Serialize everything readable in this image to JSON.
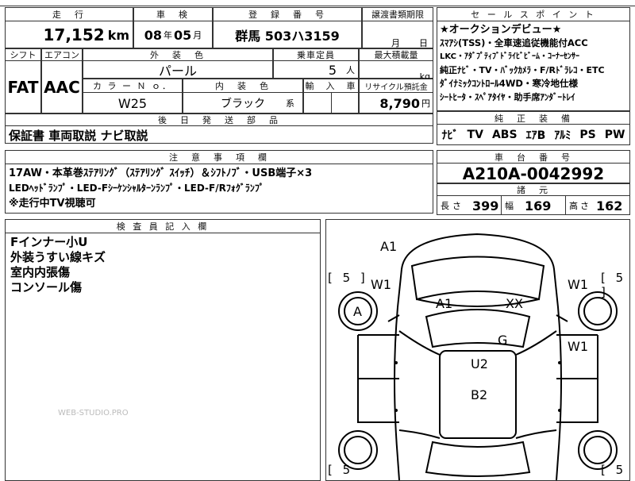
{
  "header_fragment": "",
  "mileage": {
    "label": "走　行",
    "value": "17,152",
    "unit": "km"
  },
  "inspection": {
    "label": "車　検",
    "year": "08",
    "year_unit": "年",
    "month": "05",
    "month_unit": "月"
  },
  "registration": {
    "label": "登　録　番　号",
    "value": "群馬 503ハ3159"
  },
  "transfer": {
    "label": "譲渡書類期限",
    "month_unit": "月",
    "day_unit": "日"
  },
  "shift": {
    "label": "シフト",
    "value": "FAT"
  },
  "aircon": {
    "label": "エアコン",
    "value": "AAC"
  },
  "exterior_color": {
    "label": "外　装　色",
    "value": "パール"
  },
  "capacity": {
    "label": "乗車定員",
    "value": "5",
    "unit": "人"
  },
  "max_load": {
    "label": "最大積載量",
    "unit": "kg"
  },
  "color_no": {
    "label": "カ ラ ー Ｎ ｏ．",
    "value": "W25"
  },
  "interior_color": {
    "label": "内　装　色",
    "value": "ブラック",
    "unit": "系"
  },
  "import": {
    "label": "輸　入　車"
  },
  "recycle": {
    "label": "リサイクル預託金",
    "value": "8,790",
    "unit": "円"
  },
  "later_parts": {
    "label": "後　日　発　送　部　品",
    "value": "保証書 車両取説 ナビ取説"
  },
  "sales_points": {
    "label": "セ ー ル ス ポ イ ン ト",
    "lines": [
      "★オークションデビュー★",
      "ｽﾏｱｼ(TSS)・全車速追従機能付ACC",
      "LKC・ｱﾀﾞﾌﾟﾃｨﾌﾞﾄﾞﾗｲﾋﾞﾋﾞｰﾑ・ｺｰﾅｰｾﾝｻｰ",
      "純正ﾅﾋﾞ・TV・ﾊﾞｯｸｶﾒﾗ・F/Rﾄﾞﾗﾚｺ・ETC",
      "ﾀﾞｲﾅﾐｯｸｺﾝﾄﾛｰﾙ4WD・寒冷地仕様",
      "ｼｰﾄﾋｰﾀ・ｽﾍﾟｱﾀｲﾔ・助手席ｱﾝﾀﾞｰﾄﾚｲ"
    ]
  },
  "equipment": {
    "label": "純　正　装　備",
    "items": [
      "ﾅﾋﾞ",
      "TV",
      "ABS",
      "ｴｱB",
      "ｱﾙﾐ",
      "PS",
      "PW"
    ]
  },
  "notes": {
    "label": "注　意　事　項　欄",
    "lines": [
      "17AW・本革巻ｽﾃｱﾘﾝｸﾞ（ｽﾃｱﾘﾝｸﾞ ｽｲｯﾁ）＆ｼﾌﾄﾉﾌﾞ・USB端子×3",
      "LEDﾍｯﾄﾞﾗﾝﾌﾟ・LED-Fｼｰｹﾝｼｬﾙﾀｰﾝﾗﾝﾌﾟ・LED-F/Rﾌｫｸﾞﾗﾝﾌﾟ",
      "※走行中TV視聴可"
    ]
  },
  "chassis": {
    "label": "車　台　番　号",
    "value": "A210A-0042992"
  },
  "dimensions": {
    "label": "諸　元",
    "length_label": "長さ",
    "length": "399",
    "width_label": "幅",
    "width": "169",
    "height_label": "高さ",
    "height": "162"
  },
  "inspector": {
    "label": "検 査 員 記 入 欄",
    "lines": [
      "Fインナー小U",
      "外装うすい線キズ",
      "室内内張傷",
      "コンソール傷"
    ]
  },
  "watermark": "WEB-STUDIO.PRO",
  "diagram": {
    "labels": {
      "front_top": "A1",
      "left_front": "W1",
      "right_front": "W1",
      "left_wheel": "A",
      "hood_left": "A1",
      "hood_right": "XX",
      "right_door_rear": "W1",
      "roof_g": "G",
      "roof_u2": "U2",
      "trunk_b2": "B2"
    },
    "tread": [
      "[ 5 ]",
      "[ 5 ]",
      "[ 5",
      "[ 5"
    ]
  }
}
